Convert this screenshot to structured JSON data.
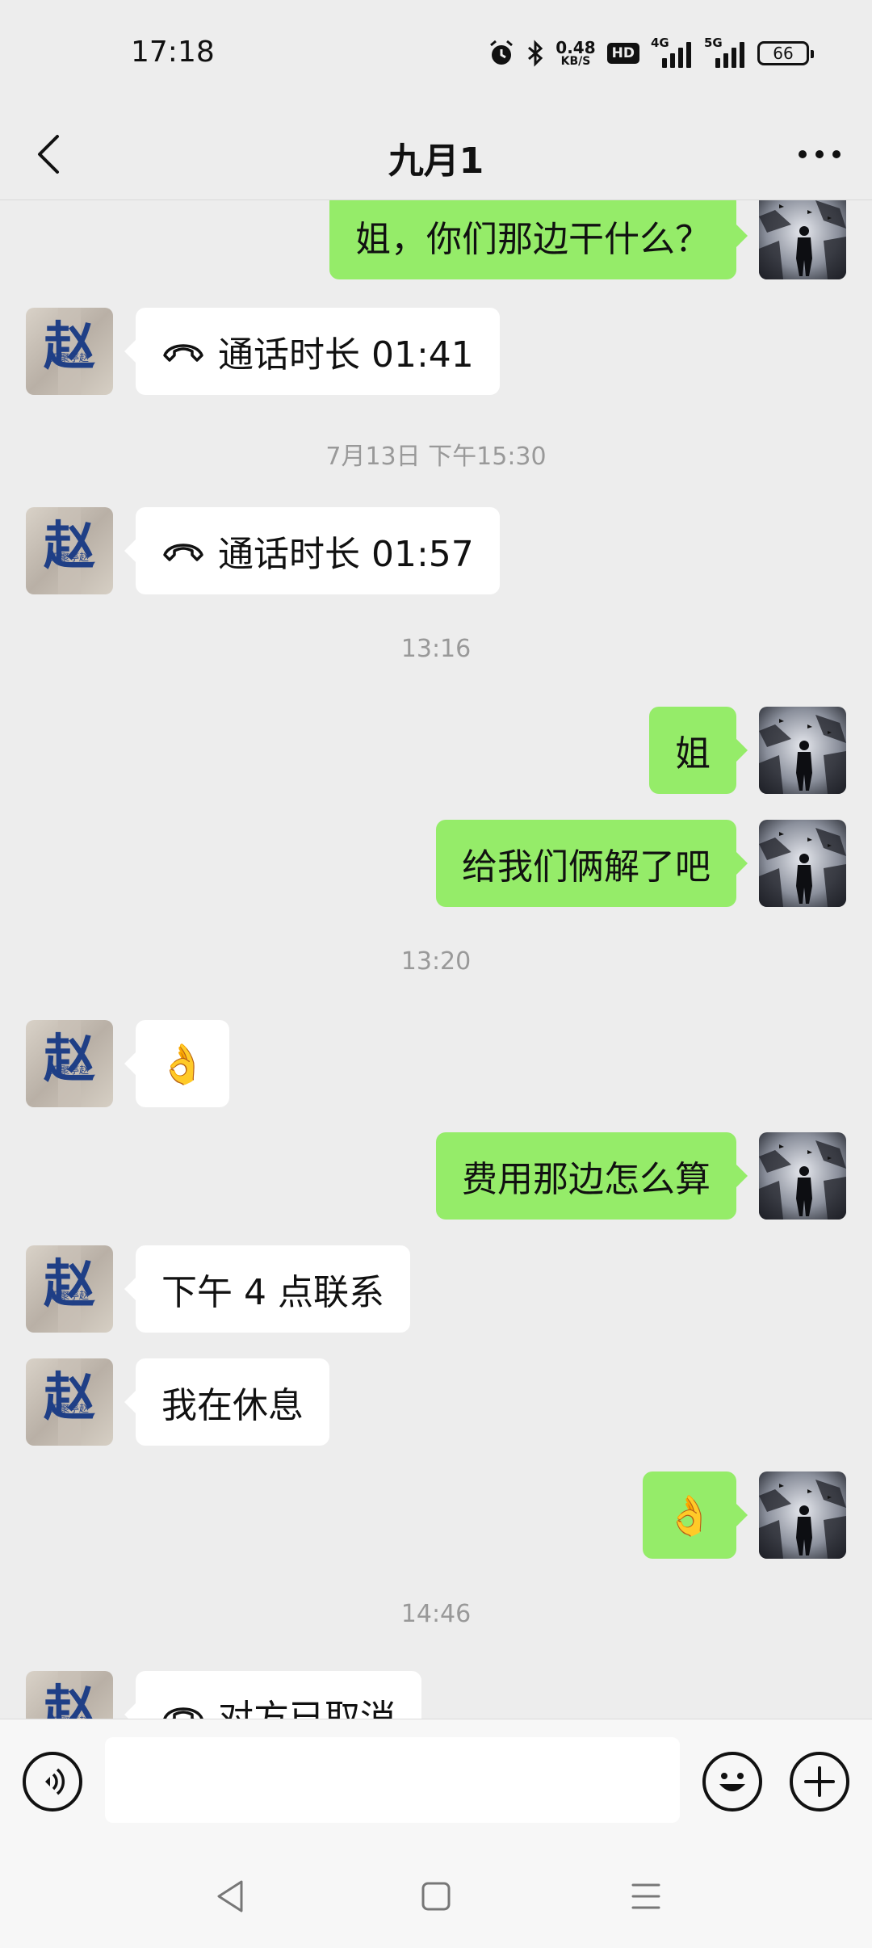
{
  "status_bar": {
    "time": "17:18",
    "net_speed_value": "0.48",
    "net_speed_unit": "KB/S",
    "hd_label": "HD",
    "signal1_label": "4G",
    "signal2_label": "5G",
    "battery": "66",
    "icons": [
      "alarm-icon",
      "bluetooth-icon",
      "hd-icon",
      "signal-4g-icon",
      "signal-5g-icon",
      "battery-icon"
    ]
  },
  "header": {
    "title": "九月1",
    "back_icon": "chevron-left-icon",
    "more_icon": "more-dots-icon"
  },
  "messages": [
    {
      "side": "me",
      "type": "text",
      "text": "姐，你们那边干什么？"
    },
    {
      "side": "them",
      "type": "call",
      "text": "通话时长 01:41"
    },
    {
      "type": "timestamp",
      "text": "7月13日 下午15:30"
    },
    {
      "side": "them",
      "type": "call",
      "text": "通话时长 01:57"
    },
    {
      "type": "timestamp",
      "text": "13:16"
    },
    {
      "side": "me",
      "type": "text",
      "text": "姐"
    },
    {
      "side": "me",
      "type": "text",
      "text": "给我们俩解了吧"
    },
    {
      "type": "timestamp",
      "text": "13:20"
    },
    {
      "side": "them",
      "type": "emoji",
      "text": "👌"
    },
    {
      "side": "me",
      "type": "text",
      "text": "费用那边怎么算"
    },
    {
      "side": "them",
      "type": "text",
      "text": "下午 4 点联系"
    },
    {
      "side": "them",
      "type": "text",
      "text": "我在休息"
    },
    {
      "side": "me",
      "type": "emoji",
      "text": "👌"
    },
    {
      "type": "timestamp",
      "text": "14:46"
    },
    {
      "side": "them",
      "type": "call",
      "text": "对方已取消"
    }
  ],
  "avatars": {
    "them_glyph": "赵",
    "me": "silhouette-avatar"
  },
  "input_bar": {
    "voice_icon": "voice-icon",
    "input_value": "",
    "emoji_icon": "emoji-smile-icon",
    "plus_icon": "plus-icon"
  },
  "system_nav": {
    "back_icon": "nav-back-icon",
    "home_icon": "nav-home-icon",
    "menu_icon": "nav-menu-icon"
  },
  "colors": {
    "background": "#EDEDED",
    "my_bubble": "#95EC69",
    "their_bubble": "#FFFFFF",
    "timestamp_text": "#999999"
  }
}
